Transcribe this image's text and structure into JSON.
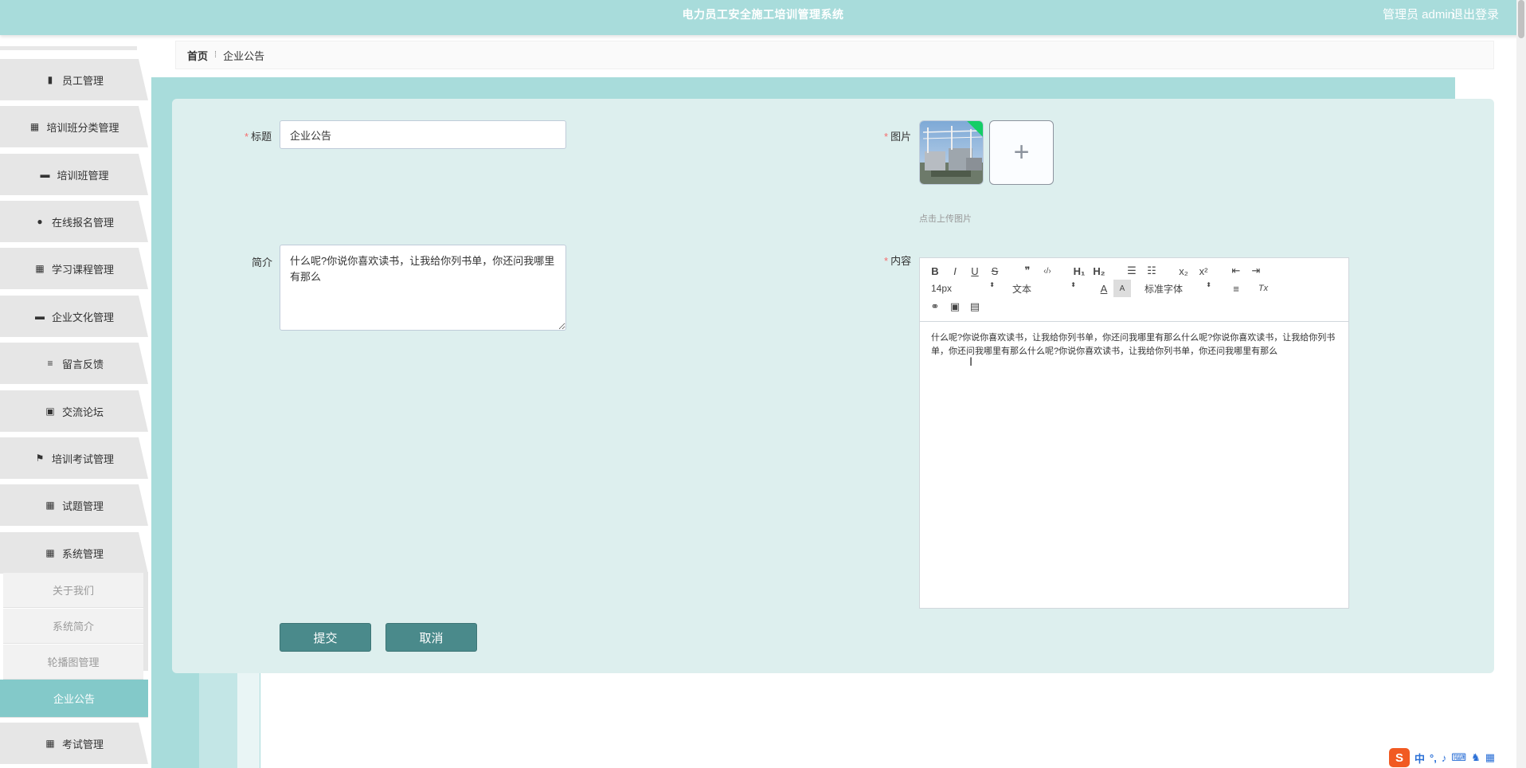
{
  "app": {
    "title": "电力员工安全施工培训管理系统",
    "user": "管理员 admin",
    "logout": "退出登录"
  },
  "sidebar": {
    "items": [
      {
        "label": "员工管理",
        "icon": "bar-chart-icon",
        "glyph": "▮"
      },
      {
        "label": "培训班分类管理",
        "icon": "grid-icon",
        "glyph": "▦"
      },
      {
        "label": "培训班管理",
        "icon": "comment-icon",
        "glyph": "▬"
      },
      {
        "label": "在线报名管理",
        "icon": "user-icon",
        "glyph": "●"
      },
      {
        "label": "学习课程管理",
        "icon": "grid-icon",
        "glyph": "▦"
      },
      {
        "label": "企业文化管理",
        "icon": "monitor-icon",
        "glyph": "▬"
      },
      {
        "label": "留言反馈",
        "icon": "list-icon",
        "glyph": "≡"
      },
      {
        "label": "交流论坛",
        "icon": "clipboard-icon",
        "glyph": "▣"
      },
      {
        "label": "培训考试管理",
        "icon": "flag-icon",
        "glyph": "⚑"
      },
      {
        "label": "试题管理",
        "icon": "grid-icon",
        "glyph": "▦"
      },
      {
        "label": "系统管理",
        "icon": "grid-icon",
        "glyph": "▦"
      }
    ],
    "sub_items": [
      {
        "label": "关于我们"
      },
      {
        "label": "系统简介"
      },
      {
        "label": "轮播图管理"
      },
      {
        "label": "企业公告"
      }
    ],
    "last_item": {
      "label": "考试管理",
      "icon": "grid-icon",
      "glyph": "▦"
    }
  },
  "breadcrumb": {
    "home": "首页",
    "separator": "⁞",
    "current": "企业公告"
  },
  "form": {
    "title_label": "标题",
    "title_value": "企业公告",
    "image_label": "图片",
    "upload_plus": "+",
    "upload_tip": "点击上传图片",
    "intro_label": "简介",
    "intro_value": "什么呢?你说你喜欢读书，让我给你列书单，你还问我哪里有那么",
    "content_label": "内容",
    "content_text": "什么呢?你说你喜欢读书，让我给你列书单，你还问我哪里有那么什么呢?你说你喜欢读书，让我给你列书单，你还问我哪里有那么什么呢?你说你喜欢读书，让我给你列书单，你还问我哪里有那么",
    "required_mark": "*",
    "submit": "提交",
    "cancel": "取消"
  },
  "editor_toolbar": {
    "bold": "B",
    "italic": "I",
    "underline": "U",
    "strike": "S",
    "quote": "❞",
    "code": "‹/›",
    "h1": "H₁",
    "h2": "H₂",
    "ordered_list": "☰",
    "bullet_list": "☷",
    "subscript": "x₂",
    "superscript": "x²",
    "outdent": "⇤",
    "indent": "⇥",
    "size": "14px",
    "header": "文本",
    "color": "A",
    "background": "A",
    "font": "标准字体",
    "align": "≡",
    "clean": "Tx",
    "link": "⚭",
    "image": "▣",
    "video": "▤",
    "dropdown_arrow": "⬍"
  },
  "ime": {
    "logo": "S",
    "chinese": "中",
    "punct": "°,",
    "mic": "♪",
    "keyboard": "⌨",
    "skin": "♞",
    "tools": "▦"
  },
  "colors": {
    "accent": "#a8dcdb",
    "panel": "#ddefee",
    "button": "#4a8a8b",
    "active_menu": "#83c9c9",
    "required": "#f56c6c"
  }
}
